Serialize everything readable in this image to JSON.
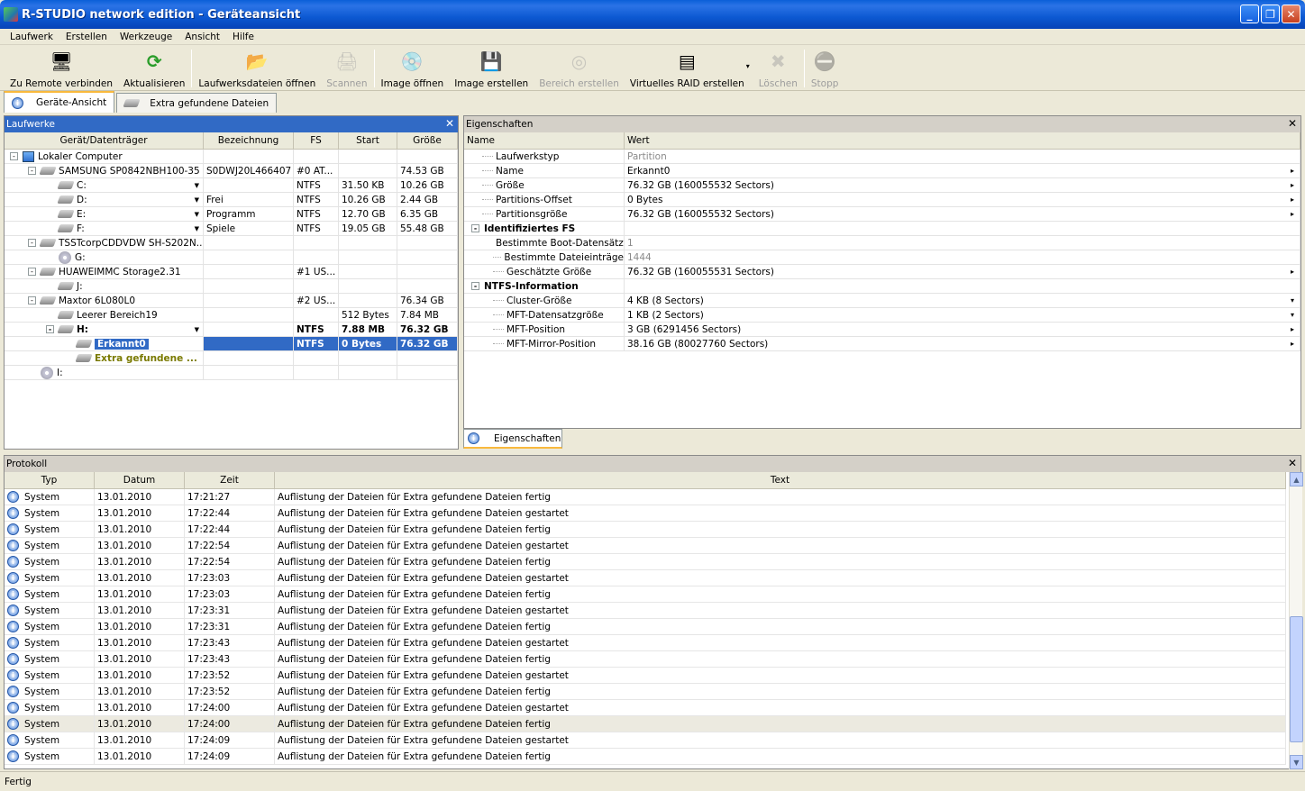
{
  "window": {
    "title": "R-STUDIO network edition - Geräteansicht"
  },
  "menu": [
    "Laufwerk",
    "Erstellen",
    "Werkzeuge",
    "Ansicht",
    "Hilfe"
  ],
  "toolbar": [
    {
      "label": "Zu Remote verbinden",
      "icon": "remote-connect-icon",
      "enabled": true
    },
    {
      "label": "Aktualisieren",
      "icon": "refresh-icon",
      "enabled": true
    },
    {
      "label": "Laufwerksdateien öffnen",
      "icon": "open-drive-files-icon",
      "enabled": true
    },
    {
      "label": "Scannen",
      "icon": "scan-icon",
      "enabled": false
    },
    {
      "label": "Image öffnen",
      "icon": "open-image-icon",
      "enabled": true
    },
    {
      "label": "Image erstellen",
      "icon": "create-image-icon",
      "enabled": true
    },
    {
      "label": "Bereich erstellen",
      "icon": "create-region-icon",
      "enabled": false
    },
    {
      "label": "Virtuelles RAID erstellen",
      "icon": "virtual-raid-icon",
      "enabled": true
    },
    {
      "label": "Löschen",
      "icon": "delete-icon",
      "enabled": false
    },
    {
      "label": "Stopp",
      "icon": "stop-icon",
      "enabled": false
    }
  ],
  "tabs": [
    {
      "label": "Geräte-Ansicht",
      "active": true
    },
    {
      "label": "Extra gefundene Dateien",
      "active": false
    }
  ],
  "drives": {
    "title": "Laufwerke",
    "columns": [
      "Gerät/Datenträger",
      "Bezeichnung",
      "FS",
      "Start",
      "Größe"
    ],
    "rows": [
      {
        "level": 0,
        "icon": "computer",
        "expander": "-",
        "name": "Lokaler Computer",
        "label": "",
        "fs": "",
        "start": "",
        "size": ""
      },
      {
        "level": 1,
        "icon": "disk",
        "expander": "-",
        "name": "SAMSUNG SP0842NBH100-35",
        "label": "S0DWJ20L466407",
        "fs": "#0 AT...",
        "start": "",
        "size": "74.53 GB"
      },
      {
        "level": 2,
        "icon": "disk",
        "expander": "",
        "name": "C:",
        "dropdown": true,
        "label": "",
        "fs": "NTFS",
        "start": "31.50 KB",
        "size": "10.26 GB"
      },
      {
        "level": 2,
        "icon": "disk",
        "expander": "",
        "name": "D:",
        "dropdown": true,
        "label": "Frei",
        "fs": "NTFS",
        "start": "10.26 GB",
        "size": "2.44 GB"
      },
      {
        "level": 2,
        "icon": "disk",
        "expander": "",
        "name": "E:",
        "dropdown": true,
        "label": "Programm",
        "fs": "NTFS",
        "start": "12.70 GB",
        "size": "6.35 GB"
      },
      {
        "level": 2,
        "icon": "disk",
        "expander": "",
        "name": "F:",
        "dropdown": true,
        "label": "Spiele",
        "fs": "NTFS",
        "start": "19.05 GB",
        "size": "55.48 GB"
      },
      {
        "level": 1,
        "icon": "disk",
        "expander": "-",
        "name": "TSSTcorpCDDVDW SH-S202N...",
        "label": "",
        "fs": "",
        "start": "",
        "size": ""
      },
      {
        "level": 2,
        "icon": "cd",
        "expander": "",
        "name": "G:",
        "label": "",
        "fs": "",
        "start": "",
        "size": ""
      },
      {
        "level": 1,
        "icon": "disk",
        "expander": "-",
        "name": "HUAWEIMMC Storage2.31",
        "label": "",
        "fs": "#1 US...",
        "start": "",
        "size": ""
      },
      {
        "level": 2,
        "icon": "disk",
        "expander": "",
        "name": "J:",
        "label": "",
        "fs": "",
        "start": "",
        "size": ""
      },
      {
        "level": 1,
        "icon": "disk",
        "expander": "-",
        "name": "Maxtor 6L080L0",
        "label": "",
        "fs": "#2 US...",
        "start": "",
        "size": "76.34 GB"
      },
      {
        "level": 2,
        "icon": "disk",
        "expander": "",
        "name": "Leerer Bereich19",
        "label": "",
        "fs": "",
        "start": "512 Bytes",
        "size": "7.84 MB"
      },
      {
        "level": 2,
        "icon": "disk",
        "expander": "-",
        "name": "H:",
        "dropdown": true,
        "bold": true,
        "label": "",
        "fs": "NTFS",
        "start": "7.88 MB",
        "size": "76.32 GB"
      },
      {
        "level": 3,
        "icon": "disk",
        "expander": "",
        "name": "Erkannt0",
        "selected": true,
        "label": "",
        "fs": "NTFS",
        "start": "0 Bytes",
        "size": "76.32 GB"
      },
      {
        "level": 3,
        "icon": "disk",
        "expander": "",
        "name": "Extra gefundene ...",
        "olive": true,
        "label": "",
        "fs": "",
        "start": "",
        "size": ""
      },
      {
        "level": 1,
        "icon": "cd",
        "expander": "",
        "name": "I:",
        "label": "",
        "fs": "",
        "start": "",
        "size": ""
      }
    ]
  },
  "properties": {
    "title": "Eigenschaften",
    "columns": [
      "Name",
      "Wert"
    ],
    "rows": [
      {
        "indent": 1,
        "name": "Laufwerkstyp",
        "value": "Partition",
        "gray": true,
        "arrow": ""
      },
      {
        "indent": 1,
        "name": "Name",
        "value": "Erkannt0",
        "arrow": "▸"
      },
      {
        "indent": 1,
        "name": "Größe",
        "value": "76.32 GB (160055532 Sectors)",
        "arrow": "▸"
      },
      {
        "indent": 1,
        "name": "Partitions-Offset",
        "value": "0 Bytes",
        "arrow": "▸"
      },
      {
        "indent": 1,
        "name": "Partitionsgröße",
        "value": "76.32 GB (160055532 Sectors)",
        "arrow": "▸"
      },
      {
        "indent": 0,
        "group": true,
        "name": "Identifiziertes FS",
        "value": "",
        "arrow": ""
      },
      {
        "indent": 2,
        "name": "Bestimmte Boot-Datensätze",
        "value": "1",
        "gray": true,
        "arrow": ""
      },
      {
        "indent": 2,
        "name": "Bestimmte Dateieinträge",
        "value": "1444",
        "gray": true,
        "arrow": ""
      },
      {
        "indent": 2,
        "name": "Geschätzte Größe",
        "value": "76.32 GB (160055531 Sectors)",
        "arrow": "▸"
      },
      {
        "indent": 0,
        "group": true,
        "name": "NTFS-Information",
        "value": "",
        "arrow": ""
      },
      {
        "indent": 2,
        "name": "Cluster-Größe",
        "value": "4 KB (8 Sectors)",
        "arrow": "▾"
      },
      {
        "indent": 2,
        "name": "MFT-Datensatzgröße",
        "value": "1 KB (2 Sectors)",
        "arrow": "▾"
      },
      {
        "indent": 2,
        "name": "MFT-Position",
        "value": "3 GB (6291456 Sectors)",
        "arrow": "▸"
      },
      {
        "indent": 2,
        "name": "MFT-Mirror-Position",
        "value": "38.16 GB (80027760 Sectors)",
        "arrow": "▸"
      }
    ],
    "tab": "Eigenschaften"
  },
  "log": {
    "title": "Protokoll",
    "columns": [
      "Typ",
      "Datum",
      "Zeit",
      "Text"
    ],
    "rows": [
      {
        "type": "System",
        "date": "13.01.2010",
        "time": "17:21:27",
        "text": "Auflistung der Dateien für Extra gefundene Dateien fertig"
      },
      {
        "type": "System",
        "date": "13.01.2010",
        "time": "17:22:44",
        "text": "Auflistung der Dateien für Extra gefundene Dateien gestartet"
      },
      {
        "type": "System",
        "date": "13.01.2010",
        "time": "17:22:44",
        "text": "Auflistung der Dateien für Extra gefundene Dateien fertig"
      },
      {
        "type": "System",
        "date": "13.01.2010",
        "time": "17:22:54",
        "text": "Auflistung der Dateien für Extra gefundene Dateien gestartet"
      },
      {
        "type": "System",
        "date": "13.01.2010",
        "time": "17:22:54",
        "text": "Auflistung der Dateien für Extra gefundene Dateien fertig"
      },
      {
        "type": "System",
        "date": "13.01.2010",
        "time": "17:23:03",
        "text": "Auflistung der Dateien für Extra gefundene Dateien gestartet"
      },
      {
        "type": "System",
        "date": "13.01.2010",
        "time": "17:23:03",
        "text": "Auflistung der Dateien für Extra gefundene Dateien fertig"
      },
      {
        "type": "System",
        "date": "13.01.2010",
        "time": "17:23:31",
        "text": "Auflistung der Dateien für Extra gefundene Dateien gestartet"
      },
      {
        "type": "System",
        "date": "13.01.2010",
        "time": "17:23:31",
        "text": "Auflistung der Dateien für Extra gefundene Dateien fertig"
      },
      {
        "type": "System",
        "date": "13.01.2010",
        "time": "17:23:43",
        "text": "Auflistung der Dateien für Extra gefundene Dateien gestartet"
      },
      {
        "type": "System",
        "date": "13.01.2010",
        "time": "17:23:43",
        "text": "Auflistung der Dateien für Extra gefundene Dateien fertig"
      },
      {
        "type": "System",
        "date": "13.01.2010",
        "time": "17:23:52",
        "text": "Auflistung der Dateien für Extra gefundene Dateien gestartet"
      },
      {
        "type": "System",
        "date": "13.01.2010",
        "time": "17:23:52",
        "text": "Auflistung der Dateien für Extra gefundene Dateien fertig"
      },
      {
        "type": "System",
        "date": "13.01.2010",
        "time": "17:24:00",
        "text": "Auflistung der Dateien für Extra gefundene Dateien gestartet"
      },
      {
        "type": "System",
        "date": "13.01.2010",
        "time": "17:24:00",
        "text": "Auflistung der Dateien für Extra gefundene Dateien fertig",
        "highlight": true
      },
      {
        "type": "System",
        "date": "13.01.2010",
        "time": "17:24:09",
        "text": "Auflistung der Dateien für Extra gefundene Dateien gestartet"
      },
      {
        "type": "System",
        "date": "13.01.2010",
        "time": "17:24:09",
        "text": "Auflistung der Dateien für Extra gefundene Dateien fertig"
      }
    ]
  },
  "status": "Fertig",
  "colors": {
    "selection": "#316ac5",
    "olive_text": "#7a7a00",
    "accent_tab": "#f9b93d"
  }
}
